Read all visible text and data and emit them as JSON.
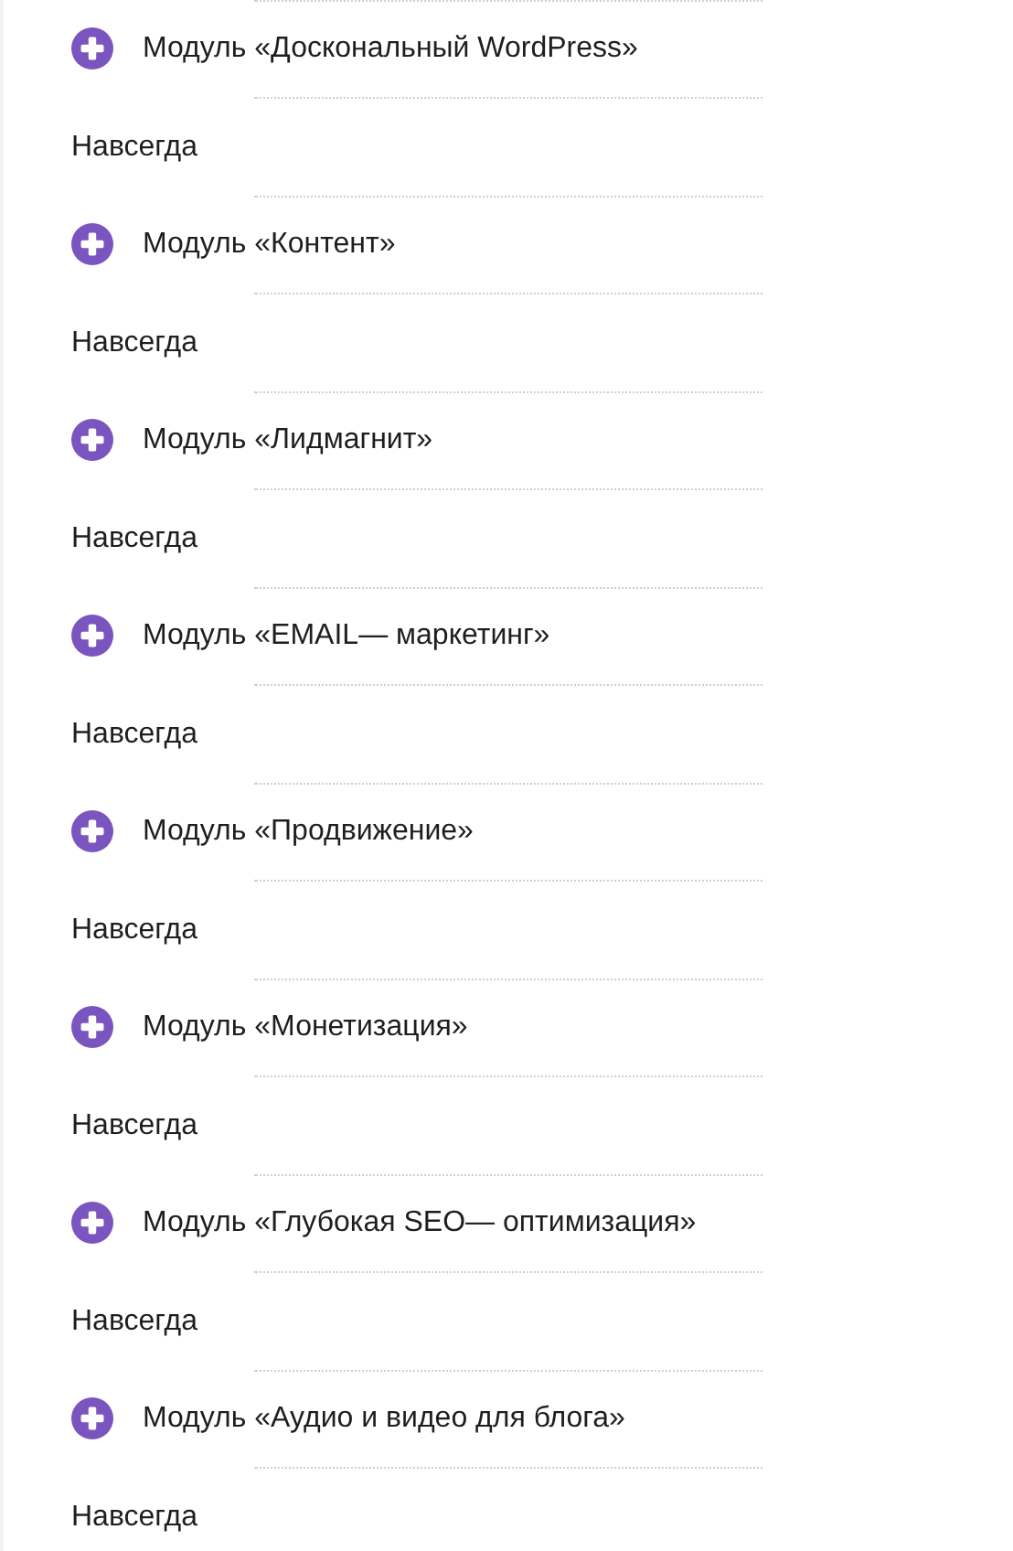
{
  "modules": [
    {
      "title": "Модуль «Доскональный WordPress»",
      "expanded": false,
      "duration": "Навсегда"
    },
    {
      "title": "Модуль «Контент»",
      "expanded": false,
      "duration": "Навсегда"
    },
    {
      "title": "Модуль «Лидмагнит»",
      "expanded": false,
      "duration": "Навсегда"
    },
    {
      "title": "Модуль «EMAIL— маркетинг»",
      "expanded": false,
      "duration": "Навсегда"
    },
    {
      "title": "Модуль «Продвижение»",
      "expanded": false,
      "duration": "Навсегда"
    },
    {
      "title": "Модуль «Монетизация»",
      "expanded": false,
      "duration": "Навсегда"
    },
    {
      "title": "Модуль «Глубокая SEO— оптимизация»",
      "expanded": false,
      "duration": "Навсегда"
    },
    {
      "title": "Модуль «Аудио и видео для блога»",
      "expanded": false,
      "duration": "Навсегда"
    }
  ]
}
